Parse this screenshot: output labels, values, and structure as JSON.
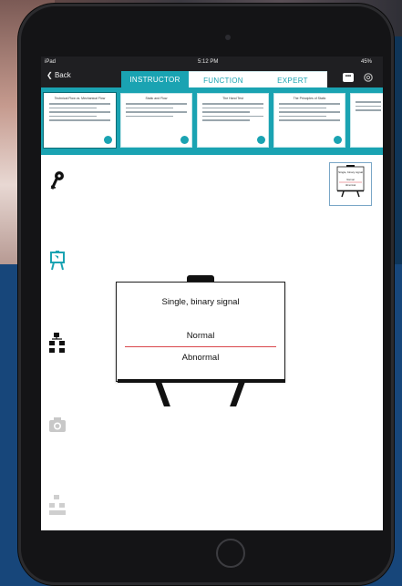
{
  "status_bar": {
    "device": "iPad",
    "time": "5:12 PM",
    "battery": "45%"
  },
  "nav": {
    "back_label": "Back",
    "tabs": [
      {
        "label": "INSTRUCTOR",
        "active": true
      },
      {
        "label": "FUNCTION",
        "active": false
      },
      {
        "label": "EXPERT",
        "active": false
      }
    ],
    "more_label": "•••"
  },
  "slides": [
    {
      "title": "Technical Flow vs. Mechanical Flow"
    },
    {
      "title": "Static and Flow"
    },
    {
      "title": "The Hand Test"
    },
    {
      "title": "The Principles of Static"
    }
  ],
  "preview": {
    "title": "Single, binary signal",
    "normal": "Normal",
    "abnormal": "Abnormal"
  },
  "easel": {
    "title": "Single, binary signal",
    "normal_label": "Normal",
    "abnormal_label": "Abnormal"
  },
  "sidebar_icons": [
    "key-icon",
    "easel-icon",
    "flowchart-icon",
    "camera-icon",
    "hierarchy-icon"
  ],
  "colors": {
    "accent": "#1aa3b2",
    "divider": "#d9474c",
    "nav_bg": "#1f1f22"
  }
}
